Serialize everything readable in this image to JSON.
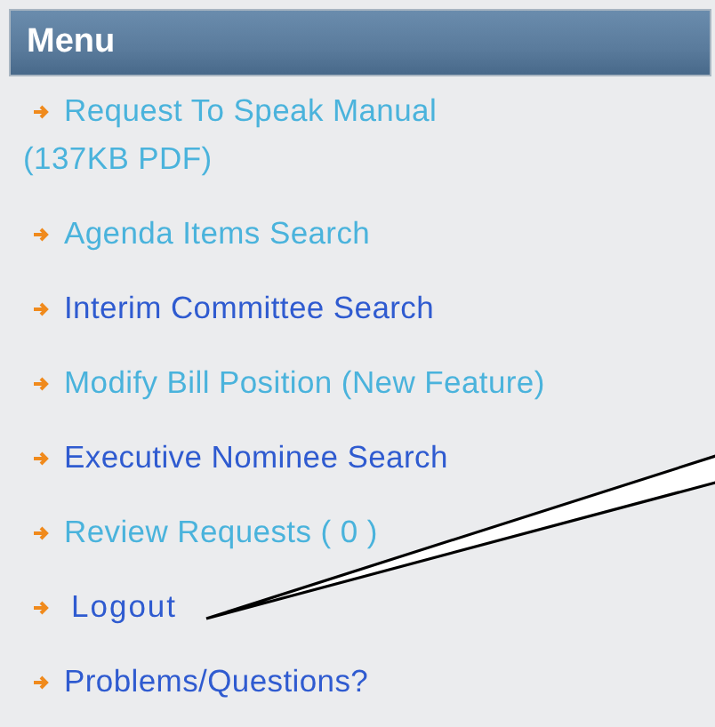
{
  "menu": {
    "title": "Menu",
    "items": [
      {
        "label": "Request To Speak Manual (137KB PDF)",
        "visited": true
      },
      {
        "label": "Agenda Items Search",
        "visited": true
      },
      {
        "label": "Interim Committee Search",
        "visited": false
      },
      {
        "label": "Modify Bill Position (New Feature)",
        "visited": true
      },
      {
        "label": "Executive Nominee Search",
        "visited": false
      },
      {
        "label": "Review Requests ( 0 )",
        "visited": true
      },
      {
        "label": "Logout",
        "visited": false
      },
      {
        "label": "Problems/Questions?",
        "visited": false
      }
    ]
  }
}
